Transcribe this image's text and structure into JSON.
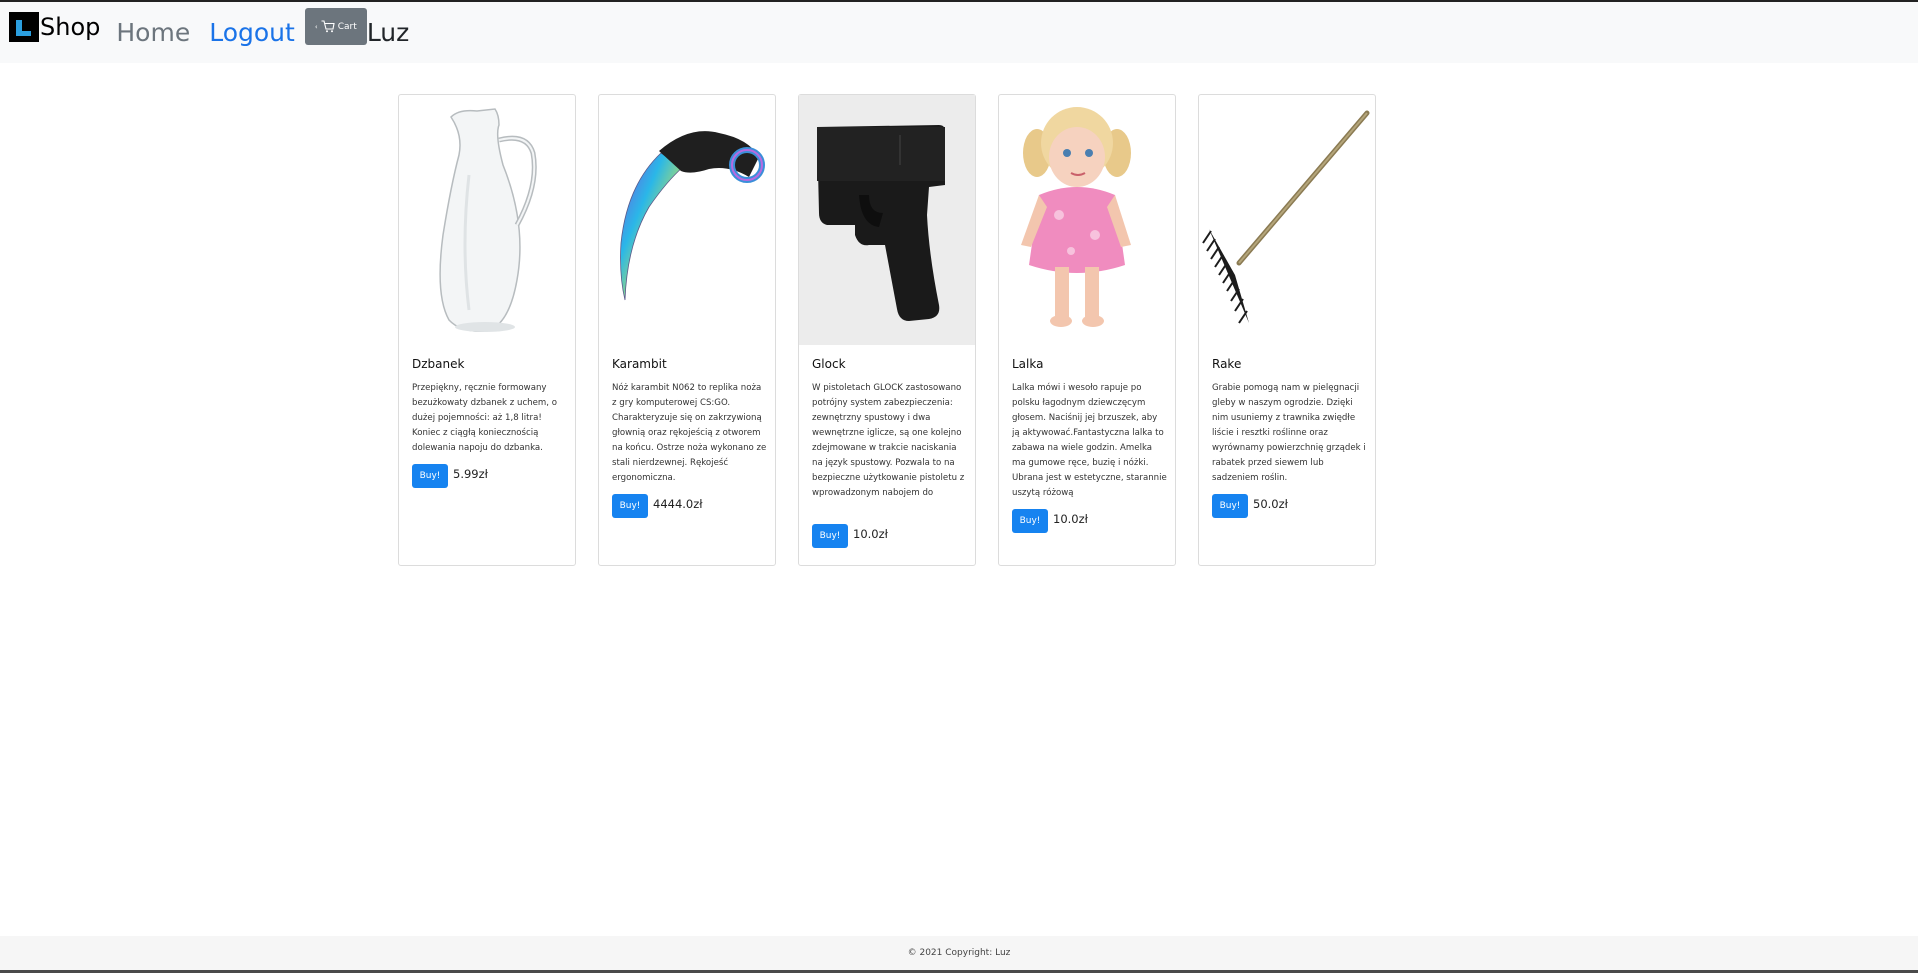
{
  "navbar": {
    "brand_text": "Shop",
    "home_label": "Home",
    "logout_label": "Logout",
    "cart_label": "Cart",
    "user_name": "Luz"
  },
  "products": [
    {
      "name": "Dzbanek",
      "description": "Przepiękny, ręcznie formowany bezużkowaty dzbanek z uchem, o dużej pojemności: aż 1,8 litra! Koniec z ciągłą koniecznością dolewania napoju do dzbanka.",
      "buy_label": "Buy!",
      "price": "5.99zł"
    },
    {
      "name": "Karambit",
      "description": "Nóż karambit N062 to replika noża z gry komputerowej CS:GO. Charakteryzuje się on zakrzywioną głownią oraz rękojeścią z otworem na końcu. Ostrze noża wykonano ze stali nierdzewnej. Rękojeść ergonomiczna.",
      "buy_label": "Buy!",
      "price": "4444.0zł"
    },
    {
      "name": "Glock",
      "description": "W pistoletach GLOCK zastosowano potrójny system zabezpieczenia: zewnętrzny spustowy i dwa wewnętrzne iglicze, są one kolejno zdejmowane w trakcie naciskania na język spustowy. Pozwala to na bezpieczne użytkowanie pistoletu z wprowadzonym nabojem do",
      "buy_label": "Buy!",
      "price": "10.0zł"
    },
    {
      "name": "Lalka",
      "description": "Lalka mówi i wesoło rapuje po polsku łagodnym dziewczęcym głosem. Naciśnij jej brzuszek, aby ją aktywować.Fantastyczna lalka to zabawa na wiele godzin. Amelka ma gumowe ręce, buzię i nóżki. Ubrana jest w estetyczne, starannie uszytą różową",
      "buy_label": "Buy!",
      "price": "10.0zł"
    },
    {
      "name": "Rake",
      "description": "Grabie pomogą nam w pielęgnacji gleby w naszym ogrodzie. Dzięki nim usuniemy z trawnika zwiędłe liście i resztki roślinne oraz wyrównamy powierzchnię grządek i rabatek przed siewem lub sadzeniem roślin.",
      "buy_label": "Buy!",
      "price": "50.0zł"
    }
  ],
  "footer": {
    "copyright": "© 2021 Copyright: Luz"
  }
}
